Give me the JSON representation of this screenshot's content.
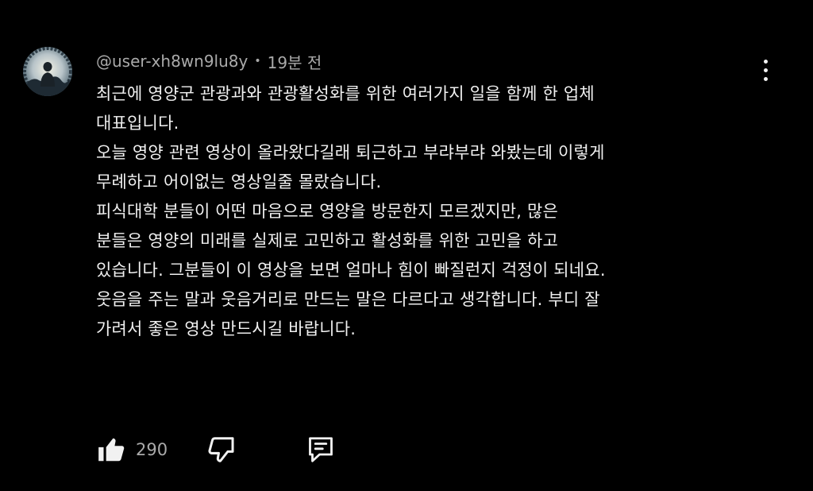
{
  "comment": {
    "author": "@user-xh8wn9lu8y",
    "separator": "•",
    "timestamp": "19분 전",
    "lines": [
      "최근에 영양군 관광과와 관광활성화를 위한 여러가지 일을 함께 한 업체",
      "대표입니다.",
      "오늘 영양 관련 영상이 올라왔다길래 퇴근하고 부랴부랴 와봤는데 이렇게",
      "무례하고 어이없는 영상일줄 몰랐습니다.",
      "피식대학 분들이 어떤 마음으로 영양을 방문한지 모르겠지만, 많은",
      "분들은 영양의 미래를 실제로 고민하고 활성화를 위한 고민을 하고",
      "있습니다. 그분들이 이 영상을 보면 얼마나 힘이 빠질런지 걱정이 되네요.",
      "웃음을 주는 말과 웃음거리로 만드는 말은 다르다고 생각합니다. 부디 잘",
      "가려서 좋은 영상 만드시길 바랍니다."
    ],
    "like_count": "290"
  },
  "icons": {
    "like": "thumbs-up-icon",
    "dislike": "thumbs-down-icon",
    "reply": "reply-comment-icon",
    "menu": "more-vertical-icon",
    "avatar": "user-avatar-photo"
  },
  "colors": {
    "background": "#000000",
    "text": "#f1f1f1",
    "secondary_text": "#aaaaaa"
  }
}
